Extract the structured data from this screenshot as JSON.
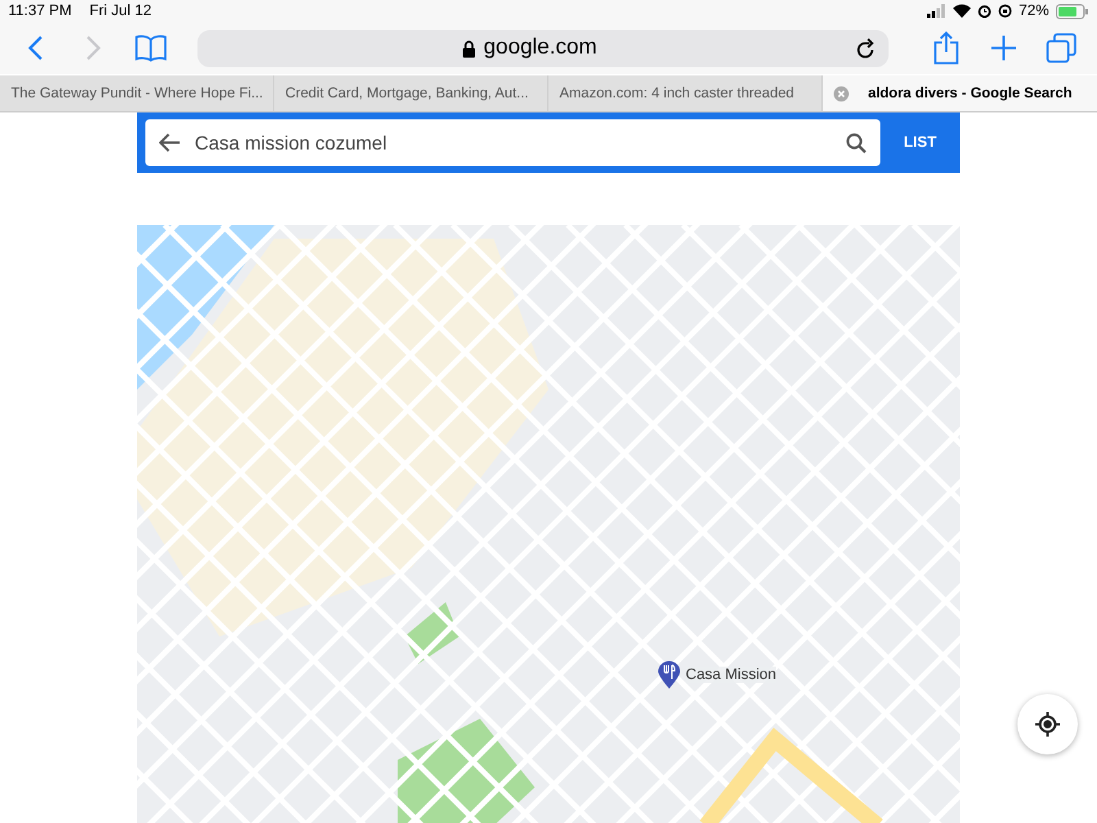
{
  "status_bar": {
    "time": "11:37 PM",
    "date": "Fri Jul 12",
    "battery": "72%"
  },
  "toolbar": {
    "address": "google.com"
  },
  "tabs": [
    {
      "label": "The Gateway Pundit - Where Hope Fi...",
      "selected": false
    },
    {
      "label": "Credit Card, Mortgage, Banking, Aut...",
      "selected": false
    },
    {
      "label": "Amazon.com: 4 inch caster threaded",
      "selected": false
    },
    {
      "label": "aldora divers - Google Search",
      "selected": true
    }
  ],
  "search": {
    "value": "Casa mission cozumel",
    "list_button": "LIST"
  },
  "map": {
    "place_label": "Casa Mission"
  }
}
